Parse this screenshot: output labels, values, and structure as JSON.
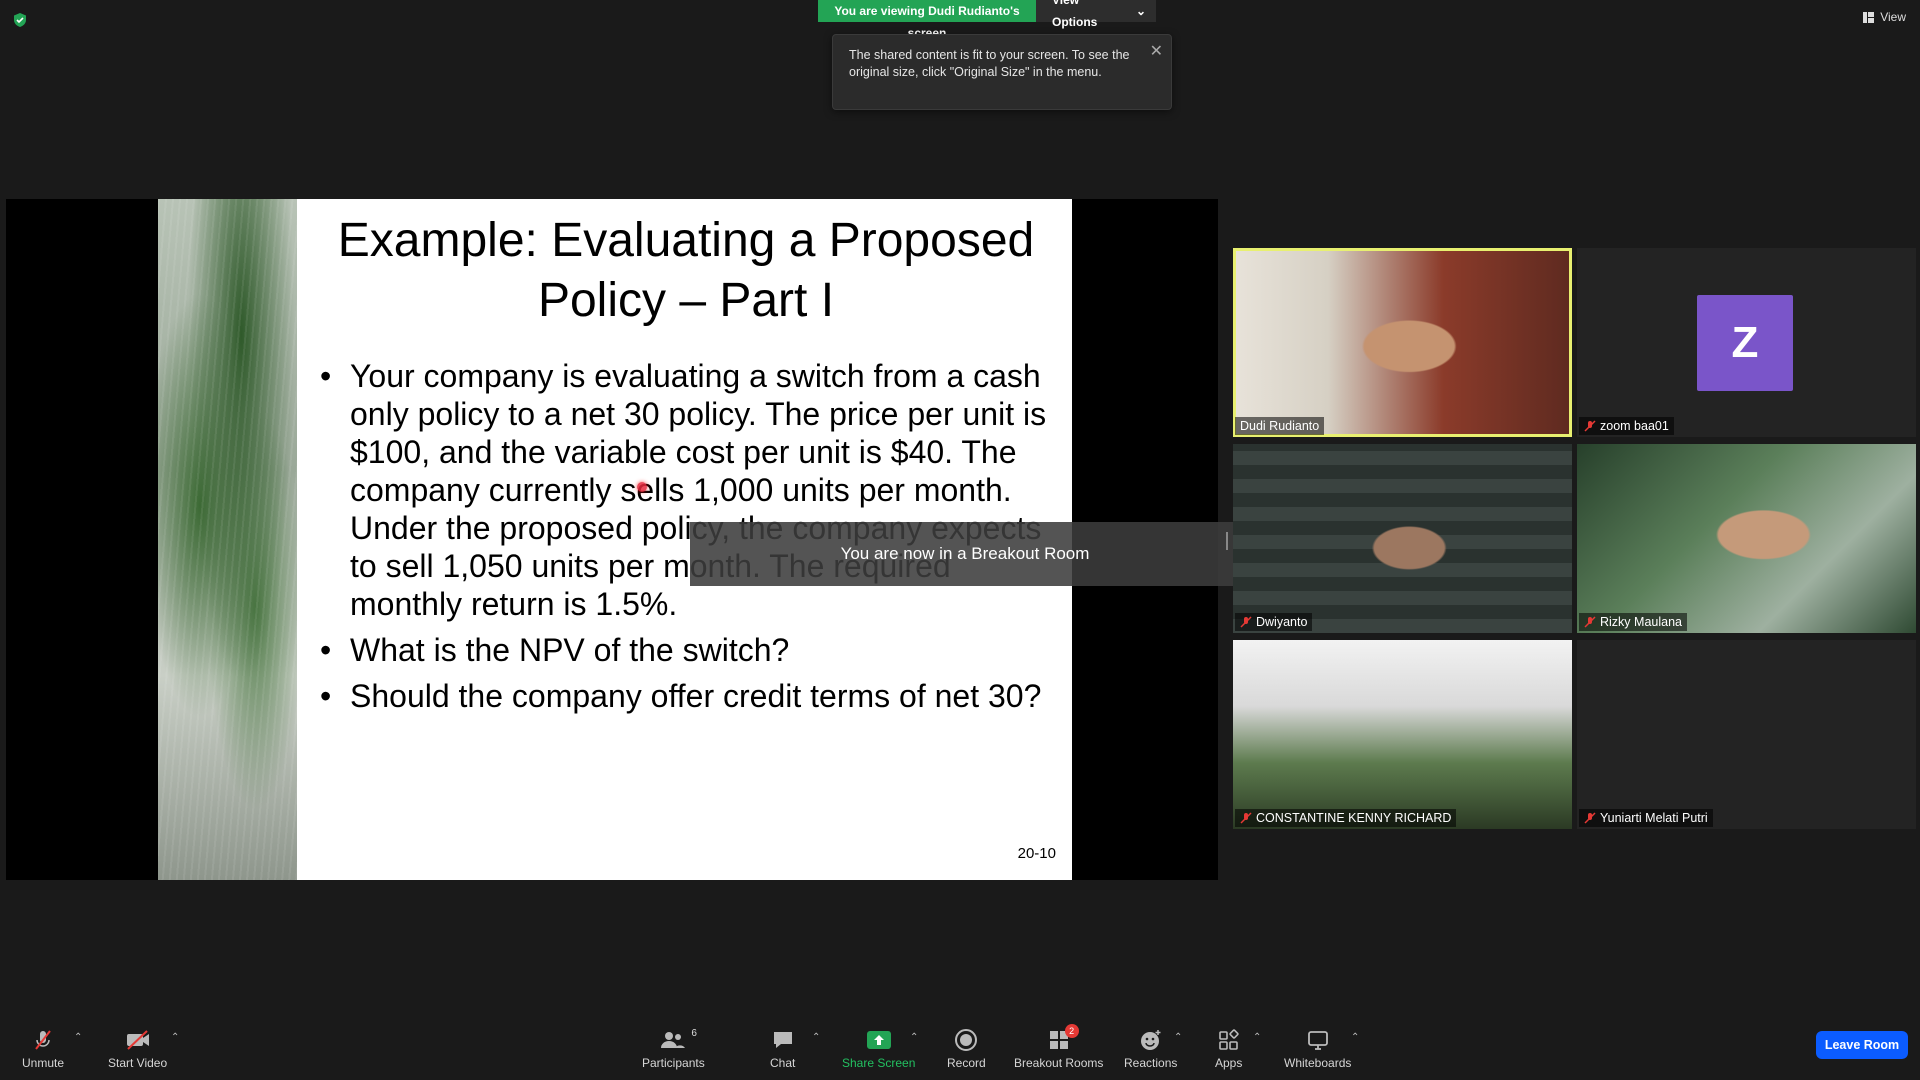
{
  "banner": {
    "viewing_text": "You are viewing Dudi Rudianto's screen",
    "view_options_label": "View Options"
  },
  "top_right": {
    "view_label": "View"
  },
  "tooltip": {
    "text": "The shared content is fit to your screen. To see the original size, click \"Original Size\" in the menu."
  },
  "slide": {
    "title": "Example: Evaluating a Proposed Policy – Part I",
    "bullets": [
      "Your company is evaluating a switch from a cash only policy to a net 30 policy. The price per unit is $100, and the variable cost per unit is $40. The company currently sells 1,000 units per month. Under the proposed policy, the company expects to sell 1,050 units per month. The required monthly return is 1.5%.",
      "What is the NPV of the switch?",
      "Should the company offer credit terms of net 30?"
    ],
    "page_number": "20-10"
  },
  "breakout_toast": "You are now in a Breakout Room",
  "participants": [
    {
      "name": "Dudi Rudianto"
    },
    {
      "name": "zoom baa01",
      "avatar_letter": "Z"
    },
    {
      "name": "Dwiyanto"
    },
    {
      "name": "Rizky Maulana"
    },
    {
      "name": "CONSTANTINE KENNY RICHARD"
    },
    {
      "name": "Yuniarti Melati Putri"
    }
  ],
  "toolbar": {
    "unmute": "Unmute",
    "start_video": "Start Video",
    "participants": "Participants",
    "participants_count": "6",
    "chat": "Chat",
    "share_screen": "Share Screen",
    "record": "Record",
    "breakout_rooms": "Breakout Rooms",
    "breakout_badge": "2",
    "reactions": "Reactions",
    "apps": "Apps",
    "whiteboards": "Whiteboards",
    "leave_room": "Leave Room"
  },
  "colors": {
    "accent_green": "#23a455",
    "leave_blue": "#0b5cff",
    "active_speaker": "#e8f070",
    "avatar_purple": "#7a55c9"
  }
}
